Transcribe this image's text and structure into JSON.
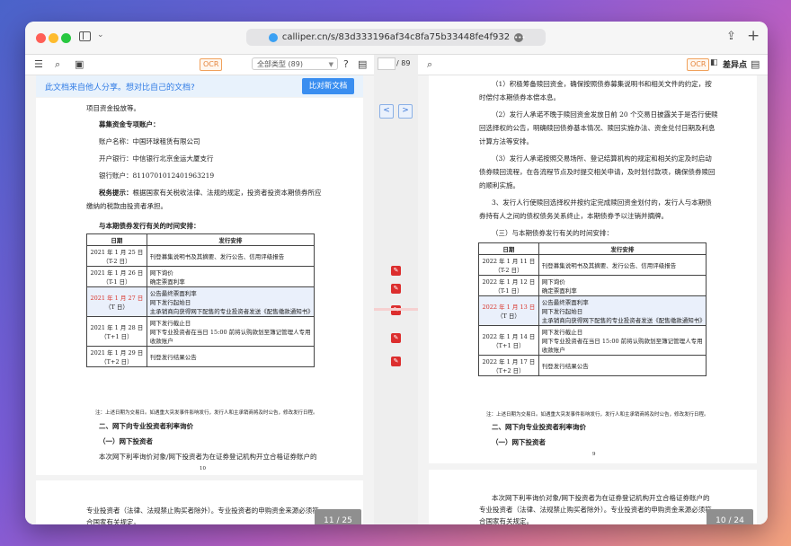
{
  "browser": {
    "url": "calliper.cn/s/83d333196af34c8fa75b33448fe4f932"
  },
  "left_toolbar": {
    "ocr": "OCR",
    "filter": "全部类型 (89)"
  },
  "banner": {
    "text": "此文档来自他人分享。想对比自己的文档?",
    "button": "比对新文档"
  },
  "center": {
    "page_total": "/ 89",
    "prev": "<",
    "next": ">"
  },
  "right_toolbar": {
    "ocr": "OCR",
    "diff": "差异点"
  },
  "left_doc": {
    "line1": "项目资金投放等。",
    "fund_title": "募集资金专项账户：",
    "account_name": "账户名称：中国环球租赁有限公司",
    "bank": "开户银行：中信银行北京金运大厦支行",
    "account_no": "银行账户：8110701012401963219",
    "tax_label": "税务提示：",
    "tax_text1": "根据国家有关税收法律、法规的规定，投资者投资本期债券所应",
    "tax_text2": "缴纳的税款由投资者承担。",
    "schedule_title": "与本期债券发行有关的时间安排：",
    "th_date": "日期",
    "th_arr": "发行安排",
    "rows": [
      {
        "d1": "2021 年 1 月 25 日",
        "d2": "（T-2 日）",
        "items": [
          "刊登募集说明书及其摘要、发行公告、信用评级报告"
        ]
      },
      {
        "d1": "2021 年 1 月 26 日",
        "d2": "（T-1 日）",
        "items": [
          "网下询价",
          "确定票面利率"
        ]
      },
      {
        "d1": "2021 年 1 月 27 日",
        "d2": "（T 日）",
        "items": [
          "公告最终票面利率",
          "网下发行起始日",
          "主承销商向获得网下配售的专业投资者发送《配售缴款通知书》"
        ]
      },
      {
        "d1": "2021 年 1 月 28 日",
        "d2": "（T+1 日）",
        "items": [
          "网下发行截止日",
          "网下专业投资者在当日 15:00 前将认购款划至簿记管理人专用收款账户"
        ]
      },
      {
        "d1": "2021 年 1 月 29 日",
        "d2": "（T+2 日）",
        "items": [
          "刊登发行结果公告"
        ]
      }
    ],
    "note": "注：上述日期为交易日。如遇重大突发事件影响发行，发行人和主承销商将及时公告，修改发行日程。",
    "sec2": "二、网下向专业投资者利率询价",
    "sec2_1": "（一）网下投资者",
    "para": "本次网下利率询价对象/网下投资者为在证券登记机构开立合格证券账户的",
    "page_no": "10",
    "next_line1": "专业投资者（法律、法规禁止购买者除外）。专业投资者的申购资金来源必须符",
    "next_line2": "合国家有关规定。",
    "badge": "11 / 25"
  },
  "right_doc": {
    "p1a": "（1）积极筹备赎回资金，确保按照债券募集说明书和相关文件的约定，按",
    "p1b": "时偿付本期债券本偿本息。",
    "p2a": "（2）发行人承诺不晚于赎回资金发放日前 20 个交易日披露关于是否行使赎",
    "p2b": "回选择权的公告，明确赎回债券基本情况、赎回实施办法、资金兑付日期及利息",
    "p2c": "计算方法等安排。",
    "p3a": "（3）发行人承诺按照交易场所、登记结算机构的规定和相关约定及时启动",
    "p3b": "债券赎回流程，在各流程节点及时提交相关申请，及时划付款项，确保债券赎回",
    "p3c": "的顺利实施。",
    "p4a": "3、发行人行使赎回选择权并按约定完成赎回资金划付的，发行人与本期债",
    "p4b": "券持有人之间的债权债务关系终止，本期债券予以注销并摘牌。",
    "schedule_title": "（三）与本期债券发行有关的时间安排：",
    "th_date": "日期",
    "th_arr": "发行安排",
    "rows": [
      {
        "d1": "2022 年 1 月 11 日",
        "d2": "（T-2 日）",
        "items": [
          "刊登募集说明书及其摘要、发行公告、信用评级报告"
        ]
      },
      {
        "d1": "2022 年 1 月 12 日",
        "d2": "（T-1 日）",
        "items": [
          "网下询价",
          "确定票面利率"
        ]
      },
      {
        "d1": "2022 年 1 月 13 日",
        "d2": "（T 日）",
        "items": [
          "公告最终票面利率",
          "网下发行起始日",
          "主承销商向获得网下配售的专业投资者发送《配售缴款通知书》"
        ]
      },
      {
        "d1": "2022 年 1 月 14 日",
        "d2": "（T+1 日）",
        "items": [
          "网下发行截止日",
          "网下专业投资者在当日 15:00 前将认购款划至簿记管理人专用收款账户"
        ]
      },
      {
        "d1": "2022 年 1 月 17 日",
        "d2": "（T+2 日）",
        "items": [
          "刊登发行结果公告"
        ]
      }
    ],
    "note": "注：上述日期为交易日。如遇重大突发事件影响发行，发行人和主承销商将及时公告，修改发行日程。",
    "sec2": "二、网下向专业投资者利率询价",
    "sec2_1": "（一）网下投资者",
    "page_no": "9",
    "next_line0": "本次网下利率询价对象/网下投资者为在证券登记机构开立合格证券账户的",
    "next_line1": "专业投资者（法律、法规禁止购买者除外）。专业投资者的申购资金来源必须符",
    "next_line2": "合国家有关规定。",
    "badge": "10 / 24"
  },
  "colors": {
    "accent": "#3a8ef0",
    "marker": "#dc2e2e",
    "ocr": "#e5853c"
  }
}
